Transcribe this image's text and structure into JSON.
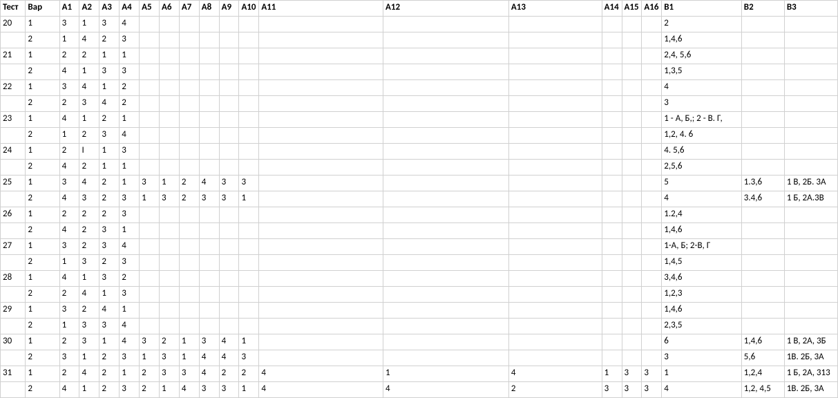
{
  "headers": [
    "Тест",
    "Вар",
    "A1",
    "A2",
    "A3",
    "A4",
    "A5",
    "A6",
    "A7",
    "A8",
    "A9",
    "A10",
    "A11",
    "A12",
    "A13",
    "A14",
    "A15",
    "A16",
    "B1",
    "B2",
    "B3"
  ],
  "rows": [
    [
      "20",
      "1",
      "3",
      "1",
      "3",
      "4",
      "",
      "",
      "",
      "",
      "",
      "",
      "",
      "",
      "",
      "",
      "",
      "",
      "2",
      "",
      ""
    ],
    [
      "",
      "2",
      "1",
      "4",
      "2",
      "3",
      "",
      "",
      "",
      "",
      "",
      "",
      "",
      "",
      "",
      "",
      "",
      "",
      "1,4,6",
      "",
      ""
    ],
    [
      "21",
      "1",
      "2",
      "2",
      "1",
      "1",
      "",
      "",
      "",
      "",
      "",
      "",
      "",
      "",
      "",
      "",
      "",
      "",
      "2,4, 5,6",
      "",
      ""
    ],
    [
      "",
      "2",
      "4",
      "1",
      "3",
      "3",
      "",
      "",
      "",
      "",
      "",
      "",
      "",
      "",
      "",
      "",
      "",
      "",
      "1,3,5",
      "",
      ""
    ],
    [
      "22",
      "1",
      "3",
      "4",
      "1",
      "2",
      "",
      "",
      "",
      "",
      "",
      "",
      "",
      "",
      "",
      "",
      "",
      "",
      "4",
      "",
      ""
    ],
    [
      "",
      "2",
      "2",
      "3",
      "4",
      "2",
      "",
      "",
      "",
      "",
      "",
      "",
      "",
      "",
      "",
      "",
      "",
      "",
      "3",
      "",
      ""
    ],
    [
      "23",
      "1",
      "4",
      "1",
      "2",
      "1",
      "",
      "",
      "",
      "",
      "",
      "",
      "",
      "",
      "",
      "",
      "",
      "",
      "1 - А, Б,; 2 - В. Г,",
      "",
      ""
    ],
    [
      "",
      "2",
      "1",
      "2",
      "3",
      "4",
      "",
      "",
      "",
      "",
      "",
      "",
      "",
      "",
      "",
      "",
      "",
      "",
      "1,2, 4. 6",
      "",
      ""
    ],
    [
      "24",
      "1",
      "2",
      "I",
      "1",
      "3",
      "",
      "",
      "",
      "",
      "",
      "",
      "",
      "",
      "",
      "",
      "",
      "",
      "4. 5,6",
      "",
      ""
    ],
    [
      "",
      "2",
      "4",
      "2",
      "1",
      "1",
      "",
      "",
      "",
      "",
      "",
      "",
      "",
      "",
      "",
      "",
      "",
      "",
      "2,5,6",
      "",
      ""
    ],
    [
      "25",
      "1",
      "3",
      "4",
      "2",
      "1",
      "3",
      "1",
      "2",
      "4",
      "3",
      "3",
      "",
      "",
      "",
      "",
      "",
      "",
      "5",
      "1.3,6",
      "1 В, 2Б. 3А"
    ],
    [
      "",
      "2",
      "4",
      "3",
      "2",
      "3",
      "1",
      "3",
      "2",
      "3",
      "3",
      "1",
      "",
      "",
      "",
      "",
      "",
      "",
      "4",
      "3.4,6",
      "1 Б, 2А.3В"
    ],
    [
      "26",
      "1",
      "2",
      "2",
      "2",
      "3",
      "",
      "",
      "",
      "",
      "",
      "",
      "",
      "",
      "",
      "",
      "",
      "",
      "1.2,4",
      "",
      ""
    ],
    [
      "",
      "2",
      "4",
      "2",
      "3",
      "1",
      "",
      "",
      "",
      "",
      "",
      "",
      "",
      "",
      "",
      "",
      "",
      "",
      "1,4,6",
      "",
      ""
    ],
    [
      "27",
      "1",
      "3",
      "2",
      "3",
      "4",
      "",
      "",
      "",
      "",
      "",
      "",
      "",
      "",
      "",
      "",
      "",
      "",
      "1-А, Б; 2-В, Г",
      "",
      ""
    ],
    [
      "",
      "2",
      "1",
      "3",
      "2",
      "3",
      "",
      "",
      "",
      "",
      "",
      "",
      "",
      "",
      "",
      "",
      "",
      "",
      "1,4,5",
      "",
      ""
    ],
    [
      "28",
      "1",
      "4",
      "1",
      "3",
      "2",
      "",
      "",
      "",
      "",
      "",
      "",
      "",
      "",
      "",
      "",
      "",
      "",
      "3,4,6",
      "",
      ""
    ],
    [
      "",
      "2",
      "2",
      "4",
      "1",
      "3",
      "",
      "",
      "",
      "",
      "",
      "",
      "",
      "",
      "",
      "",
      "",
      "",
      "1,2,3",
      "",
      ""
    ],
    [
      "29",
      "1",
      "3",
      "2",
      "4",
      "1",
      "",
      "",
      "",
      "",
      "",
      "",
      "",
      "",
      "",
      "",
      "",
      "",
      "1,4,6",
      "",
      ""
    ],
    [
      "",
      "2",
      "1",
      "3",
      "3",
      "4",
      "",
      "",
      "",
      "",
      "",
      "",
      "",
      "",
      "",
      "",
      "",
      "",
      "2,3,5",
      "",
      ""
    ],
    [
      "30",
      "1",
      "2",
      "3",
      "1",
      "4",
      "3",
      "2",
      "1",
      "3",
      "4",
      "1",
      "",
      "",
      "",
      "",
      "",
      "",
      "6",
      "1,4,6",
      "1 В, 2А, 3Б"
    ],
    [
      "",
      "2",
      "3",
      "1",
      "2",
      "3",
      "1",
      "3",
      "1",
      "4",
      "4",
      "3",
      "",
      "",
      "",
      "",
      "",
      "",
      "3",
      "5,6",
      "1В. 2Б, 3А"
    ],
    [
      "31",
      "1",
      "2",
      "4",
      "2",
      "1",
      "2",
      "3",
      "3",
      "4",
      "2",
      "2",
      "4",
      "1",
      "4",
      "1",
      "3",
      "3",
      "1",
      "1,2,4",
      "1 Б, 2А, 313"
    ],
    [
      "",
      "2",
      "4",
      "1",
      "2",
      "3",
      "2",
      "1",
      "4",
      "3",
      "3",
      "1",
      "4",
      "4",
      "2",
      "3",
      "3",
      "3",
      "4",
      "1,2, 4,5",
      "1В. 2Б, 3А"
    ]
  ]
}
